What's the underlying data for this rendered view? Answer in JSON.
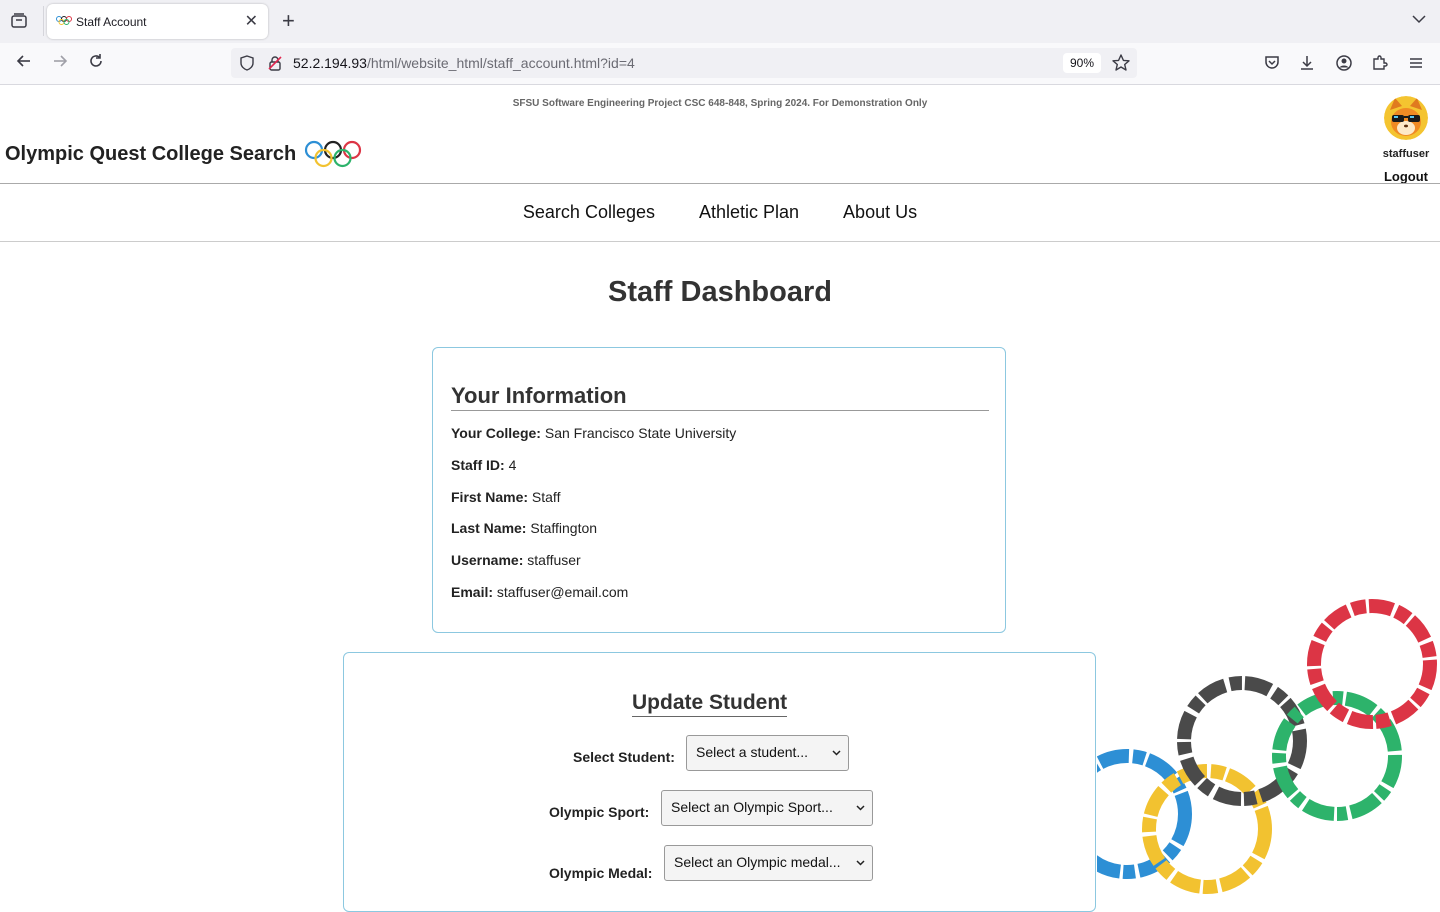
{
  "browser": {
    "tab_title": "Staff Account",
    "url_host": "52.2.194.93",
    "url_path": "/html/website_html/staff_account.html?id=4",
    "zoom": "90%"
  },
  "header": {
    "banner": "SFSU Software Engineering Project CSC 648-848, Spring 2024. For Demonstration Only",
    "site_title": "Olympic Quest College Search",
    "username": "staffuser",
    "logout": "Logout"
  },
  "nav": {
    "items": [
      "Search Colleges",
      "Athletic Plan",
      "About Us"
    ]
  },
  "dashboard": {
    "title": "Staff Dashboard"
  },
  "info": {
    "heading": "Your Information",
    "rows": [
      {
        "label": "Your College:",
        "value": "San Francisco State University"
      },
      {
        "label": "Staff ID:",
        "value": "4"
      },
      {
        "label": "First Name:",
        "value": "Staff"
      },
      {
        "label": "Last Name:",
        "value": "Staffington"
      },
      {
        "label": "Username:",
        "value": "staffuser"
      },
      {
        "label": "Email:",
        "value": "staffuser@email.com"
      }
    ]
  },
  "update": {
    "heading": "Update Student",
    "student_label": "Select Student:",
    "student_value": "Select a student...",
    "sport_label": "Olympic Sport:",
    "sport_value": "Select an Olympic Sport...",
    "medal_label": "Olympic Medal:",
    "medal_value": "Select an Olympic medal..."
  },
  "colors": {
    "accent_border": "#8cc8e0",
    "ring_blue": "#2d8fd5",
    "ring_yellow": "#f2c230",
    "ring_black": "#4a4a4a",
    "ring_green": "#2db36b",
    "ring_red": "#dc3545"
  }
}
